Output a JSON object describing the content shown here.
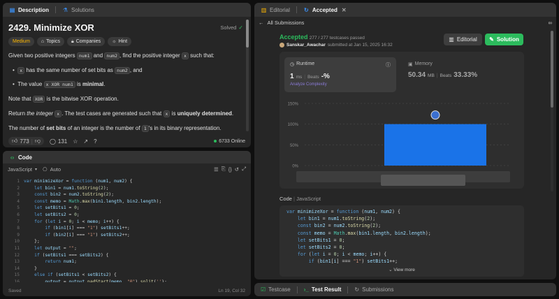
{
  "left_tabs": {
    "description": "Description",
    "solutions": "Solutions"
  },
  "problem": {
    "title": "2429. Minimize XOR",
    "status": "Solved",
    "difficulty": "Medium",
    "tags": {
      "topics": "Topics",
      "companies": "Companies",
      "hint": "Hint"
    },
    "p1_a": "Given two positive integers",
    "p1_code1": "num1",
    "p1_b": "and",
    "p1_code2": "num2",
    "p1_c": ", find the positive integer",
    "p1_code3": "x",
    "p1_d": "such that:",
    "b1_code1": "x",
    "b1_a": "has the same number of set bits as",
    "b1_code2": "num2",
    "b1_b": ", and",
    "b2_a": "The value",
    "b2_code": "x XOR num1",
    "b2_b": "is",
    "b2_strong": "minimal",
    "p2_a": "Note that",
    "p2_code": "XOR",
    "p2_b": "is the bitwise XOR operation.",
    "p3_a": "Return",
    "p3_em": "the integer",
    "p3_code": "x",
    "p3_b": ". The test cases are generated such that",
    "p3_code2": "x",
    "p3_c": "is",
    "p3_strong": "uniquely determined",
    "p4_a": "The number of",
    "p4_strong": "set bits",
    "p4_b": "of an integer is the number of",
    "p4_code": "1",
    "p4_c": "'s in its binary representation."
  },
  "desc_footer": {
    "likes": "773",
    "comments": "131",
    "online": "6733 Online"
  },
  "code_panel": {
    "tab": "Code",
    "language": "JavaScript",
    "auto": "Auto",
    "saved": "Saved",
    "cursor": "Ln 19, Col 32",
    "lines": [
      "var minimizeXor = function (num1, num2) {",
      "    let bin1 = num1.toString(2);",
      "    const bin2 = num2.toString(2);",
      "    const memo = Math.max(bin1.length, bin2.length);",
      "    let setBits1 = 0;",
      "    let setBits2 = 0;",
      "    for (let i = 0; i < memo; i++) {",
      "        if (bin1[i] === \"1\") setBits1++;",
      "        if (bin2[i] === \"1\") setBits2++;",
      "    };",
      "    let output = \"\";",
      "    if (setBits1 === setBits2) {",
      "        return num1;",
      "    }",
      "    else if (setBits1 < setBits2) {",
      "        output = output.padStart(memo, \"0\").split('');"
    ]
  },
  "right_tabs": {
    "editorial": "Editorial",
    "accepted": "Accepted"
  },
  "submission": {
    "all": "All Submissions",
    "status": "Accepted",
    "passed": "277 / 277 testcases passed",
    "user": "Sanskar_Awachar",
    "submitted": "submitted at Jan 15, 2025 16:32",
    "editorial_btn": "Editorial",
    "solution_btn": "Solution",
    "runtime_label": "Runtime",
    "runtime_value": "1",
    "runtime_unit": "ms",
    "runtime_beats_label": "Beats",
    "runtime_beats": "-%",
    "analyze": "Analyze Complexity",
    "memory_label": "Memory",
    "memory_value": "50.34",
    "memory_unit": "MB",
    "memory_beats_label": "Beats",
    "memory_beats": "33.33%",
    "code_label": "Code",
    "code_lang": "JavaScript",
    "view_more": "View more",
    "code_lines": [
      "var minimizeXor = function (num1, num2) {",
      "    let bin1 = num1.toString(2);",
      "    const bin2 = num2.toString(2);",
      "    const memo = Math.max(bin1.length, bin2.length);",
      "    let setBits1 = 0;",
      "    let setBits2 = 0;",
      "    for (let i = 0; i < memo; i++) {",
      "        if (bin1[i] === \"1\") setBits1++;"
    ]
  },
  "chart_data": {
    "type": "bar",
    "ticks": [
      "150%",
      "100%",
      "50%",
      "0%"
    ],
    "ylim": [
      0,
      150
    ],
    "values": [
      100
    ],
    "color": "#1a73e8"
  },
  "bottom_tabs": {
    "testcase": "Testcase",
    "result": "Test Result",
    "submissions": "Submissions"
  },
  "colors": {
    "accent_green": "#2cbb5d",
    "medium": "#ffb800",
    "blue": "#1a73e8"
  }
}
